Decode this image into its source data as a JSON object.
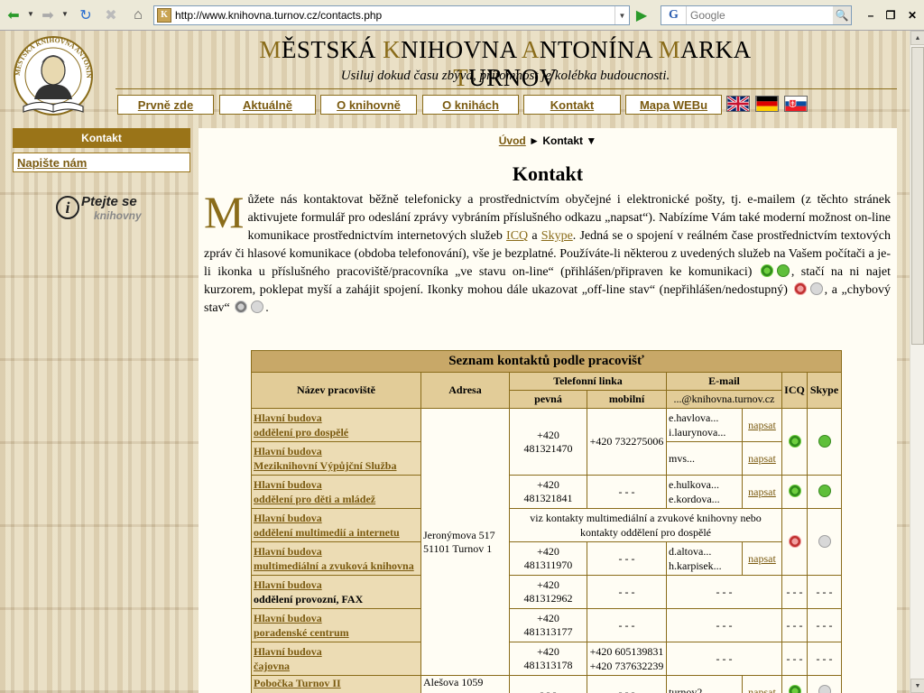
{
  "browser": {
    "url": "http://www.knihovna.turnov.cz/contacts.php",
    "search_placeholder": "Google",
    "search_engine_letter": "G"
  },
  "header": {
    "title_parts": [
      {
        "cap": "M",
        "rest": "ĚSTSKÁ "
      },
      {
        "cap": "K",
        "rest": "NIHOVNA "
      },
      {
        "cap": "A",
        "rest": "NTONÍNA "
      },
      {
        "cap": "M",
        "rest": "ARKA "
      },
      {
        "cap": "T",
        "rest": "URNOV"
      }
    ],
    "motto": "Usiluj dokud času zbývá, přítomnost je kolébka budoucnosti.",
    "logo_text": "MĚSTSKÁ KNIHOVNA ANTONÍNA MARKA TURNOV"
  },
  "nav": [
    {
      "label": "Prvně zde"
    },
    {
      "label": "Aktuálně"
    },
    {
      "label": "O knihovně"
    },
    {
      "label": "O knihách"
    },
    {
      "label": "Kontakt"
    },
    {
      "label": "Mapa WEBu"
    }
  ],
  "flags": [
    "uk-flag",
    "de-flag",
    "sk-flag"
  ],
  "sidebar": {
    "heading": "Kontakt",
    "link": "Napište nám",
    "ask_line1": "Ptejte se",
    "ask_line2": "knihovny"
  },
  "breadcrumb": {
    "home": "Úvod",
    "current": "Kontakt"
  },
  "page_title": "Kontakt",
  "intro": {
    "drop_cap": "M",
    "p1": "ůžete nás kontaktovat běžně telefonicky a prostřednictvím obyčejné i elektronické pošty, tj. e-mailem (z těchto stránek aktivujete formulář pro odeslání zprávy vybráním příslušného odkazu „napsat“). Nabízíme Vám také moderní možnost on-line komunikace prostřednictvím internetových služeb ",
    "icq": "ICQ",
    "a": " a ",
    "skype": "Skype",
    "p2": ". Jedná se o spojení v reálném čase prostřednictvím textových zpráv či hlasové komunikace (obdoba telefonování), vše je bezplatné. Používáte-li některou z uvedených služeb na Vašem počítači a je-li ikonka u příslušného pracoviště/pracovníka „ve stavu on-line“ (přihlášen/připraven ke komunikaci) ",
    "p3": ", stačí na ni najet kurzorem, poklepat myší a zahájit spojení. Ikonky mohou dále ukazovat „off-line stav“ (nepřihlášen/nedostupný) ",
    "p4": ", a „chybový stav“ ",
    "p5": "."
  },
  "table": {
    "caption": "Seznam kontaktů podle pracovišť",
    "headers": {
      "name": "Název pracoviště",
      "address": "Adresa",
      "phone": "Telefonní linka",
      "phone_fixed": "pevná",
      "phone_mobile": "mobilní",
      "email": "E-mail",
      "email_domain": "...@knihovna.turnov.cz",
      "icq": "ICQ",
      "skype": "Skype"
    },
    "address_main": "Jeronýmova 517",
    "address_main2": "51101 Turnov 1",
    "address_branch": "Alešova 1059",
    "napsat": "napsat",
    "dash": "- - -",
    "multimedia_note": "viz kontakty multimediální a zvukové knihovny nebo kontakty oddělení pro dospělé",
    "rows": [
      {
        "line1": "Hlavní budova",
        "line2": "oddělení pro dospělé",
        "fixed": "+420 481321470",
        "mobile": "+420 732275006",
        "email1": "e.havlova...",
        "email2": "i.laurynova..."
      },
      {
        "line1": "Hlavní budova",
        "line2": "Meziknihovní Výpůjční Služba",
        "email1": "mvs..."
      },
      {
        "line1": "Hlavní budova",
        "line2": "oddělení pro děti a mládež",
        "fixed": "+420 481321841",
        "email1": "e.hulkova...",
        "email2": "e.kordova..."
      },
      {
        "line1": "Hlavní budova",
        "line2": "oddělení multimedií a internetu"
      },
      {
        "line1": "Hlavní budova",
        "line2": "multimediální a zvuková knihovna",
        "fixed": "+420 481311970",
        "email1": "d.altova...",
        "email2": "h.karpisek..."
      },
      {
        "line1": "Hlavní budova",
        "line2": "oddělení provozní, FAX",
        "fixed": "+420 481312962"
      },
      {
        "line1": "Hlavní budova",
        "line2": "poradenské centrum",
        "fixed": "+420 481313177"
      },
      {
        "line1": "Hlavní budova",
        "line2": "čajovna",
        "fixed": "+420 481313178",
        "mobile1": "+420 605139831",
        "mobile2": "+420 737632239"
      },
      {
        "line1": "Pobočka Turnov II",
        "email1": "turnov2..."
      }
    ]
  },
  "colors": {
    "gold": "#8a6c1a",
    "sidebar": "#9a7418",
    "table_head": "#c8a868"
  }
}
